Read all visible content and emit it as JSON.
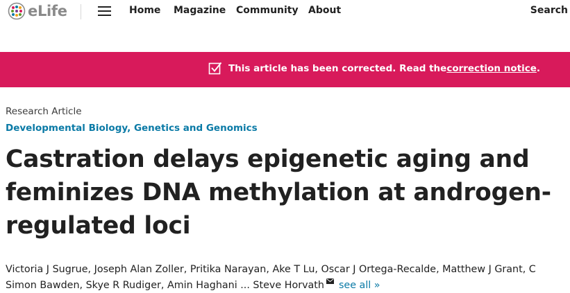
{
  "header": {
    "logo_text": "eLife",
    "nav": [
      "Home",
      "Magazine",
      "Community",
      "About"
    ],
    "search_label": "Search"
  },
  "banner": {
    "text_before": "This article has been corrected. Read the ",
    "link_text": "correction notice",
    "text_after": ".",
    "color": "#d81a5b"
  },
  "article": {
    "type": "Research Article",
    "subjects": "Developmental Biology, Genetics and Genomics",
    "title": "Castration delays epigenetic aging and feminizes DNA methylation at androgen-regulated loci",
    "authors_line1": "Victoria J Sugrue, Joseph Alan Zoller, Pritika Narayan, Ake T Lu, Oscar J Ortega-Recalde, Matthew J Grant, C",
    "authors_line2": "Simon Bawden, Skye R Rudiger, Amin Haghani ... Steve Horvath",
    "see_all": "see all »"
  },
  "colors": {
    "accent_link": "#0a7aa6",
    "brand_grey": "#8a8a8a"
  }
}
